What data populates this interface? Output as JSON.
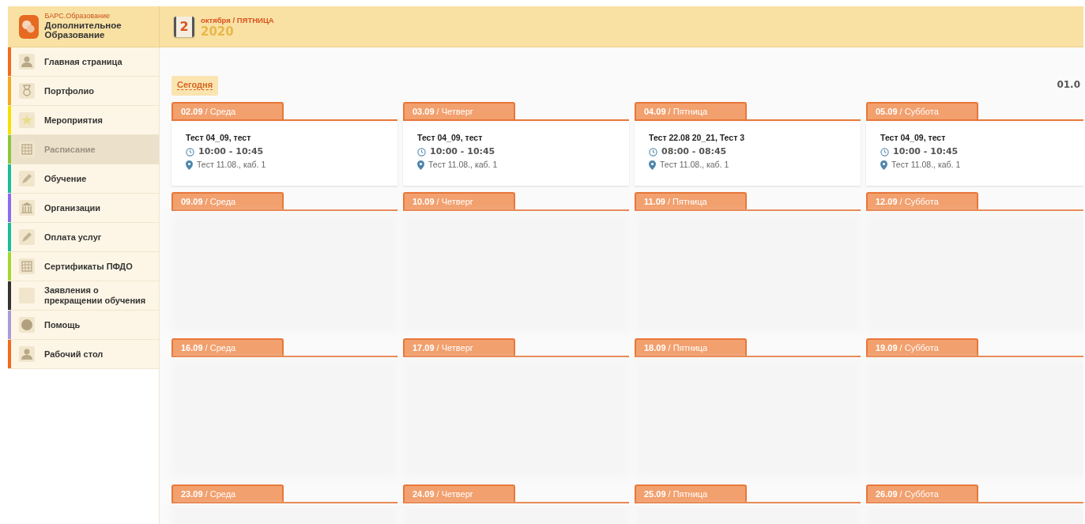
{
  "brand": {
    "subtitle": "БАРС.Образование",
    "title": "Дополнительное Образование"
  },
  "header": {
    "day": "2",
    "month_weekday": "октября / ПЯТНИЦА",
    "year": "2020"
  },
  "sidebar": {
    "items": [
      {
        "label": "Главная страница",
        "color": "#f26b1d",
        "selected": false
      },
      {
        "label": "Портфолио",
        "color": "#f7a823",
        "selected": false
      },
      {
        "label": "Мероприятия",
        "color": "#f5e100",
        "selected": false
      },
      {
        "label": "Расписание",
        "color": "#8cc63f",
        "selected": true
      },
      {
        "label": "Обучение",
        "color": "#1abc9c",
        "selected": false
      },
      {
        "label": "Организации",
        "color": "#8b6cf0",
        "selected": false
      },
      {
        "label": "Оплата услуг",
        "color": "#1abc9c",
        "selected": false
      },
      {
        "label": "Сертификаты ПФДО",
        "color": "#a3d82e",
        "selected": false
      },
      {
        "label": "Заявления о прекращении обучения",
        "color": "#333333",
        "selected": false
      },
      {
        "label": "Помощь",
        "color": "#a99be0",
        "selected": false
      },
      {
        "label": "Рабочий стол",
        "color": "#f26b1d",
        "selected": false
      }
    ]
  },
  "today_button": "Сегодня",
  "range_label": "01.0",
  "weeks": [
    {
      "days": [
        {
          "label": "**02.09** / Среда",
          "events": [
            {
              "title": "Тест 04_09, тест",
              "time": "10:00 - 10:45",
              "place": "Тест 11.08., каб. 1"
            }
          ]
        },
        {
          "label": "**03.09** / Четверг",
          "events": [
            {
              "title": "Тест 04_09, тест",
              "time": "10:00 - 10:45",
              "place": "Тест 11.08., каб. 1"
            }
          ]
        },
        {
          "label": "**04.09** / Пятница",
          "events": [
            {
              "title": "Тест 22.08 20_21, Тест 3",
              "time": "08:00 - 08:45",
              "place": "Тест 11.08., каб. 1"
            }
          ]
        },
        {
          "label": "**05.09** / Суббота",
          "events": [
            {
              "title": "Тест 04_09, тест",
              "time": "10:00 - 10:45",
              "place": "Тест 11.08., каб. 1"
            }
          ]
        }
      ]
    },
    {
      "days": [
        {
          "label": "**09.09** / Среда"
        },
        {
          "label": "**10.09** / Четверг"
        },
        {
          "label": "**11.09** / Пятница"
        },
        {
          "label": "**12.09** / Суббота"
        }
      ]
    },
    {
      "days": [
        {
          "label": "**16.09** / Среда"
        },
        {
          "label": "**17.09** / Четверг"
        },
        {
          "label": "**18.09** / Пятница"
        },
        {
          "label": "**19.09** / Суббота"
        }
      ]
    },
    {
      "days": [
        {
          "label": "**23.09** / Среда"
        },
        {
          "label": "**24.09** / Четверг"
        },
        {
          "label": "**25.09** / Пятница"
        },
        {
          "label": "**26.09** / Суббота"
        }
      ]
    }
  ]
}
